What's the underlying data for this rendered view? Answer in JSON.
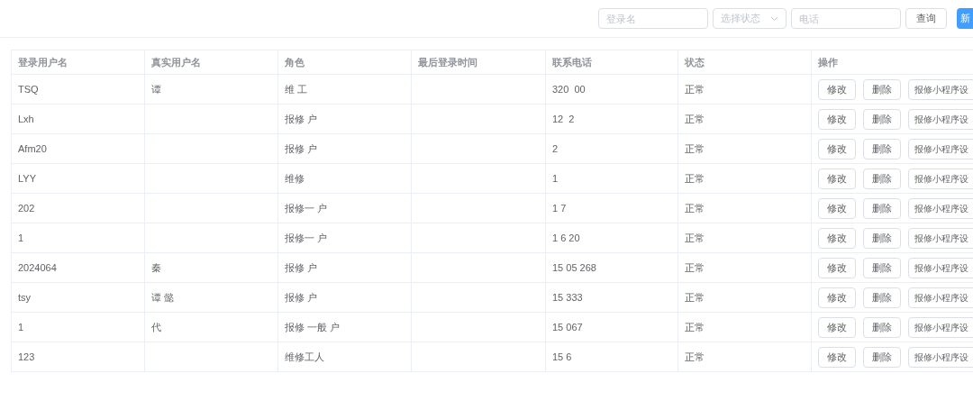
{
  "toolbar": {
    "login_field": {
      "placeholder": "登录名"
    },
    "status_select": {
      "placeholder": "选择状态"
    },
    "phone_field": {
      "placeholder": "电话"
    },
    "search_button": "查询",
    "new_button": "新"
  },
  "table": {
    "columns": [
      "登录用户名",
      "真实用户名",
      "角色",
      "最后登录时间",
      "联系电话",
      "状态",
      "操作"
    ],
    "rows": [
      {
        "login": "TSQ",
        "name": "谭",
        "role": "维 工",
        "last_login": "",
        "phone": "320  00",
        "status": "正常",
        "actions": [
          "修改",
          "删除",
          "报修小程序设"
        ]
      },
      {
        "login": "Lxh",
        "name": "",
        "role": "报修 户",
        "last_login": "",
        "phone": "12  2",
        "status": "正常",
        "actions": [
          "修改",
          "删除",
          "报修小程序设"
        ]
      },
      {
        "login": "Afm20",
        "name": "",
        "role": "报修 户",
        "last_login": "",
        "phone": "2",
        "status": "正常",
        "actions": [
          "修改",
          "删除",
          "报修小程序设"
        ]
      },
      {
        "login": "LYY",
        "name": "",
        "role": "维修",
        "last_login": "",
        "phone": "1",
        "status": "正常",
        "actions": [
          "修改",
          "删除",
          "报修小程序设"
        ]
      },
      {
        "login": "202",
        "name": "",
        "role": "报修一 户",
        "last_login": "",
        "phone": "1 7",
        "status": "正常",
        "actions": [
          "修改",
          "删除",
          "报修小程序设"
        ]
      },
      {
        "login": "1",
        "name": "",
        "role": "报修一 户",
        "last_login": "",
        "phone": "1 6 20",
        "status": "正常",
        "actions": [
          "修改",
          "删除",
          "报修小程序设"
        ]
      },
      {
        "login": "2024064",
        "name": "秦",
        "role": "报修 户",
        "last_login": "",
        "phone": "15 05 268",
        "status": "正常",
        "actions": [
          "修改",
          "删除",
          "报修小程序设"
        ]
      },
      {
        "login": "tsy",
        "name": "谭 懿",
        "role": "报修 户",
        "last_login": "",
        "phone": "15 333",
        "status": "正常",
        "actions": [
          "修改",
          "删除",
          "报修小程序设"
        ]
      },
      {
        "login": "1",
        "name": "代",
        "role": "报修 一般 户",
        "last_login": "",
        "phone": "15 067",
        "status": "正常",
        "actions": [
          "修改",
          "删除",
          "报修小程序设"
        ]
      },
      {
        "login": "123",
        "name": "",
        "role": "维修工人",
        "last_login": "",
        "phone": "15 6",
        "status": "正常",
        "actions": [
          "修改",
          "删除",
          "报修小程序设"
        ]
      }
    ]
  }
}
